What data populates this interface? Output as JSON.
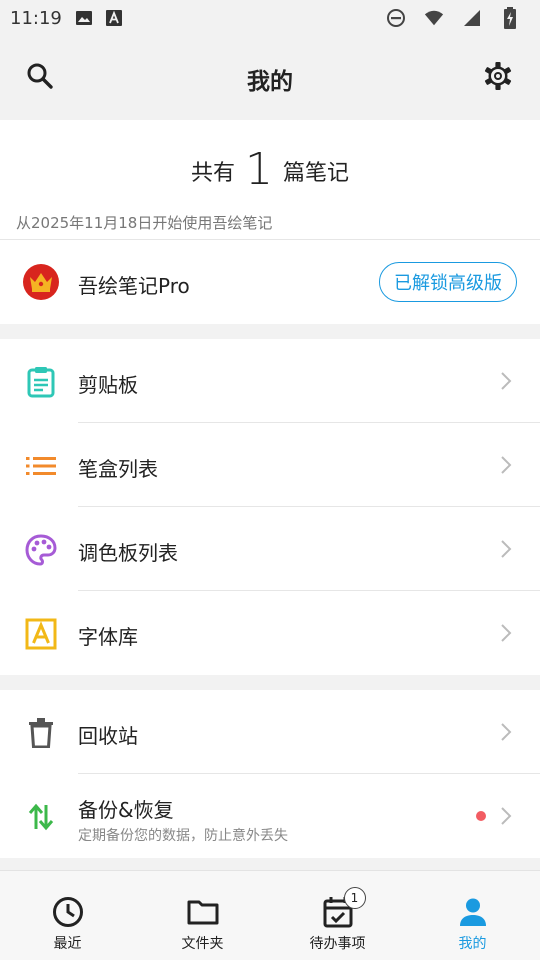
{
  "status_bar": {
    "time": "11:19",
    "icons": [
      "image-icon",
      "font-a-icon",
      "do-not-disturb-icon",
      "wifi-icon",
      "signal-icon",
      "battery-charging-icon"
    ]
  },
  "header": {
    "title": "我的",
    "search_icon": "search-icon",
    "settings_icon": "gear-icon"
  },
  "summary": {
    "prefix": "共有",
    "count": "1",
    "suffix": "篇笔记",
    "since": "从2025年11月18日开始使用吾绘笔记"
  },
  "pro": {
    "label": "吾绘笔记Pro",
    "button": "已解锁高级版",
    "icon": "crown-icon",
    "accent": "#1a9ae0"
  },
  "tools": [
    {
      "label": "剪贴板",
      "icon": "clipboard-icon",
      "color": "#2ec7b6"
    },
    {
      "label": "笔盒列表",
      "icon": "list-icon",
      "color": "#f28a2b"
    },
    {
      "label": "调色板列表",
      "icon": "palette-icon",
      "color": "#a65bd6"
    },
    {
      "label": "字体库",
      "icon": "font-box-icon",
      "color": "#f2b817"
    }
  ],
  "data_items": [
    {
      "label": "回收站",
      "icon": "trash-icon",
      "color": "#555555"
    },
    {
      "label": "备份&恢复",
      "sub": "定期备份您的数据，防止意外丢失",
      "icon": "swap-arrows-icon",
      "color": "#3cb84a",
      "dot_color": "#f25c62"
    }
  ],
  "bottom_nav": [
    {
      "label": "最近",
      "icon": "clock-icon",
      "active": false
    },
    {
      "label": "文件夹",
      "icon": "folder-icon",
      "active": false
    },
    {
      "label": "待办事项",
      "icon": "calendar-check-icon",
      "badge": "1",
      "active": false
    },
    {
      "label": "我的",
      "icon": "person-icon",
      "active": true
    }
  ]
}
